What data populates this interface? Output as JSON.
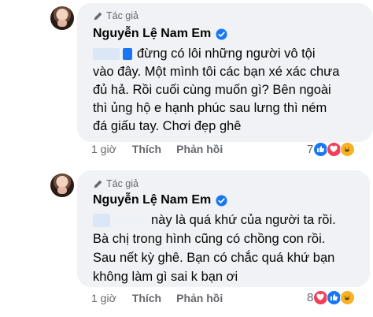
{
  "comments": [
    {
      "author_badge": "Tác giả",
      "author_name": "Nguyễn Lệ Nam Em",
      "lines": [
        "đừng có lôi những người vô tội",
        "vào đây. Một mình tôi các bạn xé xác chưa",
        "đủ hả. Rồi cuối cùng muốn gì? Bên ngoài",
        "thì ủng hộ e hạnh phúc sau lưng thì ném",
        "đá giấu tay. Chơi đẹp ghê"
      ],
      "time": "1 giờ",
      "like_label": "Thích",
      "reply_label": "Phản hồi",
      "reaction_count": "7",
      "reactions": [
        "like-icon",
        "love-icon",
        "haha-icon"
      ]
    },
    {
      "author_badge": "Tác giả",
      "author_name": "Nguyễn Lệ Nam Em",
      "lines": [
        "này là quá khứ của người ta rồi.",
        "Bà chị trong hình cũng có chồng con rồi.",
        "Sau nết kỳ ghê. Bạn có chắc quá khứ bạn",
        "không làm gì sai k bạn ơi"
      ],
      "time": "1 giờ",
      "like_label": "Thích",
      "reply_label": "Phản hồi",
      "reaction_count": "8",
      "reactions": [
        "love-icon",
        "like-icon",
        "haha-icon"
      ]
    }
  ],
  "colors": {
    "bubble_bg": "#f0f2f5",
    "muted_text": "#65676b",
    "verified_blue": "#1877f2",
    "like_blue": "#1877f2",
    "love_red": "#f33e58",
    "haha_yellow": "#f7b125"
  }
}
